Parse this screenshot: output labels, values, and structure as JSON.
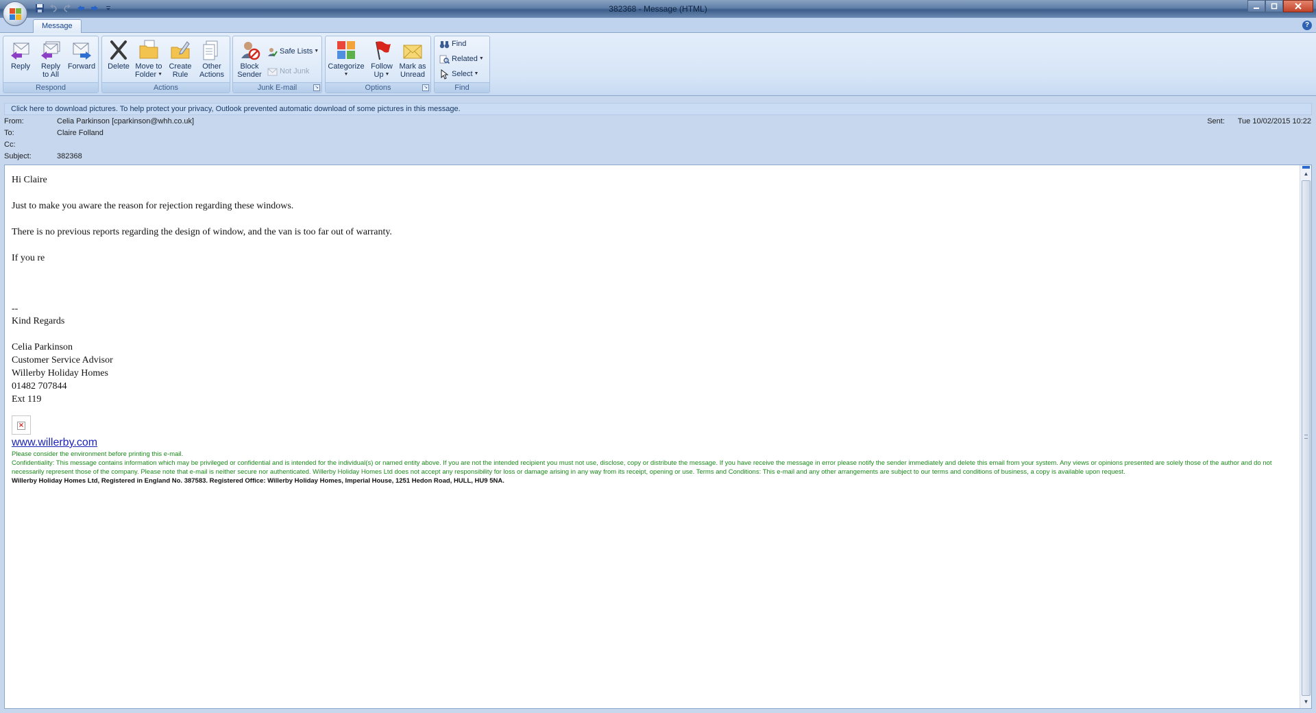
{
  "window": {
    "title": "382368 - Message (HTML)"
  },
  "ribbon": {
    "tab": "Message",
    "groups": {
      "respond": {
        "label": "Respond",
        "reply": "Reply",
        "reply_all_1": "Reply",
        "reply_all_2": "to All",
        "forward": "Forward"
      },
      "actions": {
        "label": "Actions",
        "delete": "Delete",
        "move_1": "Move to",
        "move_2": "Folder",
        "create_1": "Create",
        "create_2": "Rule",
        "other_1": "Other",
        "other_2": "Actions"
      },
      "junk": {
        "label": "Junk E-mail",
        "block_1": "Block",
        "block_2": "Sender",
        "safe_lists": "Safe Lists",
        "not_junk": "Not Junk"
      },
      "options": {
        "label": "Options",
        "categorize": "Categorize",
        "follow_1": "Follow",
        "follow_2": "Up",
        "mark_1": "Mark as",
        "mark_2": "Unread"
      },
      "find": {
        "label": "Find",
        "find": "Find",
        "related": "Related",
        "select": "Select"
      }
    }
  },
  "infobar": "Click here to download pictures. To help protect your privacy, Outlook prevented automatic download of some pictures in this message.",
  "headers": {
    "from_label": "From:",
    "from": "Celia Parkinson [cparkinson@whh.co.uk]",
    "to_label": "To:",
    "to": "Claire Folland",
    "cc_label": "Cc:",
    "cc": "",
    "subject_label": "Subject:",
    "subject": "382368",
    "sent_label": "Sent:",
    "sent": "Tue 10/02/2015 10:22"
  },
  "message": {
    "greeting": "Hi Claire",
    "line1": "Just to make you aware the reason for rejection regarding these windows.",
    "line2": "There is no previous reports regarding the design of window, and the van is too far out of warranty.",
    "line3": "If you re",
    "sig_sep": "--",
    "regards": "Kind Regards",
    "name": "Celia Parkinson",
    "role": "Customer Service Advisor",
    "company": "Willerby Holiday Homes",
    "phone": "01482 707844",
    "ext": "Ext 119",
    "website": "www.willerby.com",
    "env_notice": "Please consider the environment before printing this e-mail.",
    "confidentiality": "Confidentiality: This message contains information which may be privileged or confidential and is intended for the individual(s) or named entity above. If you are not the intended recipient you must not use, disclose, copy or distribute the message. If you have receive the message in error please notify the sender immediately and delete this email from your system. Any views or opinions presented are solely those of the author and do not necessarily represent those of the company. Please note that e-mail is neither secure nor authenticated. Willerby Holiday Homes Ltd does not accept any responsibility for loss or damage arising in any way from its receipt, opening or use. Terms and Conditions: This e-mail and any other arrangements are subject to our terms and conditions of business, a copy is available upon request.",
    "registration": "Willerby Holiday Homes Ltd, Registered in England No. 387583. Registered Office: Willerby Holiday Homes, Imperial House, 1251 Hedon Road, HULL, HU9 5NA."
  },
  "colors": {
    "accent": "#15428b",
    "link": "#1a23b8",
    "disclaimer_green": "#1a8a1a"
  }
}
